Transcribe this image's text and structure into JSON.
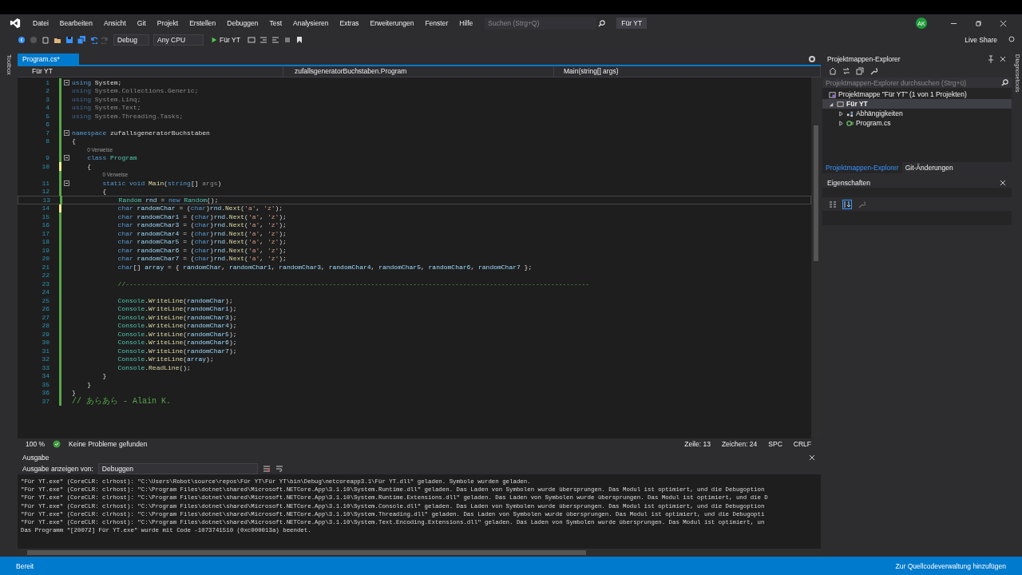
{
  "menu": [
    "Datei",
    "Bearbeiten",
    "Ansicht",
    "Git",
    "Projekt",
    "Erstellen",
    "Debuggen",
    "Test",
    "Analysieren",
    "Extras",
    "Erweiterungen",
    "Fenster",
    "Hilfe"
  ],
  "search": {
    "placeholder": "Suchen (Strg+Q)"
  },
  "solution_name": "Für YT",
  "account": "AK",
  "toolbar": {
    "config": "Debug",
    "platform": "Any CPU",
    "run": "Für YT"
  },
  "live_share": "Live Share",
  "toolbox_tab": "Toolbox",
  "diagnostics_tab": "Diagnosetools",
  "editor": {
    "tab": "Program.cs*",
    "nav": [
      "Für YT",
      "zufallsgeneratorBuchstaben.Program",
      "Main(string[] args)"
    ],
    "lines": [
      {
        "kind": "code",
        "n": "1",
        "fold": true,
        "unsaved": false,
        "current": false,
        "tokens": [
          {
            "kind": "kw",
            "text": "using"
          },
          {
            "kind": "p",
            "text": " System;"
          }
        ]
      },
      {
        "kind": "code",
        "n": "2",
        "fold": false,
        "unsaved": false,
        "current": false,
        "tokens": [
          {
            "kind": "kwdim",
            "text": "using"
          },
          {
            "kind": "dim",
            "text": " System.Collections.Generic;"
          }
        ]
      },
      {
        "kind": "code",
        "n": "3",
        "fold": false,
        "unsaved": false,
        "current": false,
        "tokens": [
          {
            "kind": "kwdim",
            "text": "using"
          },
          {
            "kind": "dim",
            "text": " System.Linq;"
          }
        ]
      },
      {
        "kind": "code",
        "n": "4",
        "fold": false,
        "unsaved": false,
        "current": false,
        "tokens": [
          {
            "kind": "kwdim",
            "text": "using"
          },
          {
            "kind": "dim",
            "text": " System.Text;"
          }
        ]
      },
      {
        "kind": "code",
        "n": "5",
        "fold": false,
        "unsaved": false,
        "current": false,
        "tokens": [
          {
            "kind": "kwdim",
            "text": "using"
          },
          {
            "kind": "dim",
            "text": " System.Threading.Tasks;"
          }
        ]
      },
      {
        "kind": "code",
        "n": "6",
        "fold": false,
        "unsaved": false,
        "current": false
      },
      {
        "kind": "code",
        "n": "7",
        "fold": true,
        "unsaved": false,
        "current": false,
        "tokens": [
          {
            "kind": "kw",
            "text": "namespace"
          },
          {
            "kind": "p",
            "text": " zufallsgeneratorBuchstaben"
          }
        ]
      },
      {
        "kind": "code",
        "n": "8",
        "fold": false,
        "unsaved": false,
        "current": false,
        "tokens": [
          {
            "kind": "p",
            "text": "{"
          }
        ]
      },
      {
        "kind": "lens",
        "text": "0 Verweise"
      },
      {
        "kind": "code",
        "n": "9",
        "fold": true,
        "unsaved": false,
        "current": false,
        "tokens": [
          {
            "kind": "kw",
            "text": "    class"
          },
          {
            "kind": "type",
            "text": " Program"
          }
        ]
      },
      {
        "kind": "code",
        "n": "10",
        "fold": false,
        "unsaved": true,
        "current": false,
        "tokens": [
          {
            "kind": "p",
            "text": "    {"
          }
        ]
      },
      {
        "kind": "lens",
        "text": "0 Verweise"
      },
      {
        "kind": "code",
        "n": "11",
        "fold": true,
        "unsaved": false,
        "current": false,
        "tokens": [
          {
            "kind": "kw",
            "text": "        static"
          },
          {
            "kind": "kw",
            "text": " void"
          },
          {
            "kind": "m",
            "text": " Main"
          },
          {
            "kind": "p",
            "text": "("
          },
          {
            "kind": "kw",
            "text": "string"
          },
          {
            "kind": "p",
            "text": "[] "
          },
          {
            "kind": "dim",
            "text": "args"
          },
          {
            "kind": "p",
            "text": ")"
          }
        ]
      },
      {
        "kind": "code",
        "n": "12",
        "fold": false,
        "unsaved": false,
        "current": false,
        "tokens": [
          {
            "kind": "p",
            "text": "        {"
          }
        ]
      },
      {
        "kind": "code",
        "n": "13",
        "fold": false,
        "unsaved": false,
        "current": true,
        "tokens": [
          {
            "kind": "type",
            "text": "            Random"
          },
          {
            "kind": "id",
            "text": " rnd"
          },
          {
            "kind": "p",
            "text": " = "
          },
          {
            "kind": "kw",
            "text": "new"
          },
          {
            "kind": "type",
            "text": " Random"
          },
          {
            "kind": "p",
            "text": "();"
          }
        ]
      },
      {
        "kind": "code",
        "n": "14",
        "fold": false,
        "unsaved": true,
        "current": false,
        "tokens": [
          {
            "kind": "kw",
            "text": "            char"
          },
          {
            "kind": "id",
            "text": " randomChar"
          },
          {
            "kind": "p",
            "text": " = ("
          },
          {
            "kind": "kw",
            "text": "char"
          },
          {
            "kind": "p",
            "text": ")"
          },
          {
            "kind": "id",
            "text": "rnd"
          },
          {
            "kind": "p",
            "text": "."
          },
          {
            "kind": "m",
            "text": "Next"
          },
          {
            "kind": "p",
            "text": "("
          },
          {
            "kind": "s",
            "text": "'a'"
          },
          {
            "kind": "p",
            "text": ", "
          },
          {
            "kind": "s",
            "text": "'z'"
          },
          {
            "kind": "p",
            "text": ");"
          }
        ]
      },
      {
        "kind": "code",
        "n": "15",
        "fold": false,
        "unsaved": false,
        "current": false,
        "tokens": [
          {
            "kind": "kw",
            "text": "            char"
          },
          {
            "kind": "id",
            "text": " randomChar1"
          },
          {
            "kind": "p",
            "text": " = ("
          },
          {
            "kind": "kw",
            "text": "char"
          },
          {
            "kind": "p",
            "text": ")"
          },
          {
            "kind": "id",
            "text": "rnd"
          },
          {
            "kind": "p",
            "text": "."
          },
          {
            "kind": "m",
            "text": "Next"
          },
          {
            "kind": "p",
            "text": "("
          },
          {
            "kind": "s",
            "text": "'a'"
          },
          {
            "kind": "p",
            "text": ", "
          },
          {
            "kind": "s",
            "text": "'z'"
          },
          {
            "kind": "p",
            "text": ");"
          }
        ]
      },
      {
        "kind": "code",
        "n": "16",
        "fold": false,
        "unsaved": false,
        "current": false,
        "tokens": [
          {
            "kind": "kw",
            "text": "            char"
          },
          {
            "kind": "id",
            "text": " randomChar3"
          },
          {
            "kind": "p",
            "text": " = ("
          },
          {
            "kind": "kw",
            "text": "char"
          },
          {
            "kind": "p",
            "text": ")"
          },
          {
            "kind": "id",
            "text": "rnd"
          },
          {
            "kind": "p",
            "text": "."
          },
          {
            "kind": "m",
            "text": "Next"
          },
          {
            "kind": "p",
            "text": "("
          },
          {
            "kind": "s",
            "text": "'a'"
          },
          {
            "kind": "p",
            "text": ", "
          },
          {
            "kind": "s",
            "text": "'z'"
          },
          {
            "kind": "p",
            "text": ");"
          }
        ]
      },
      {
        "kind": "code",
        "n": "17",
        "fold": false,
        "unsaved": false,
        "current": false,
        "tokens": [
          {
            "kind": "kw",
            "text": "            char"
          },
          {
            "kind": "id",
            "text": " randomChar4"
          },
          {
            "kind": "p",
            "text": " = ("
          },
          {
            "kind": "kw",
            "text": "char"
          },
          {
            "kind": "p",
            "text": ")"
          },
          {
            "kind": "id",
            "text": "rnd"
          },
          {
            "kind": "p",
            "text": "."
          },
          {
            "kind": "m",
            "text": "Next"
          },
          {
            "kind": "p",
            "text": "("
          },
          {
            "kind": "s",
            "text": "'a'"
          },
          {
            "kind": "p",
            "text": ", "
          },
          {
            "kind": "s",
            "text": "'z'"
          },
          {
            "kind": "p",
            "text": ");"
          }
        ]
      },
      {
        "kind": "code",
        "n": "18",
        "fold": false,
        "unsaved": false,
        "current": false,
        "tokens": [
          {
            "kind": "kw",
            "text": "            char"
          },
          {
            "kind": "id",
            "text": " randomChar5"
          },
          {
            "kind": "p",
            "text": " = ("
          },
          {
            "kind": "kw",
            "text": "char"
          },
          {
            "kind": "p",
            "text": ")"
          },
          {
            "kind": "id",
            "text": "rnd"
          },
          {
            "kind": "p",
            "text": "."
          },
          {
            "kind": "m",
            "text": "Next"
          },
          {
            "kind": "p",
            "text": "("
          },
          {
            "kind": "s",
            "text": "'a'"
          },
          {
            "kind": "p",
            "text": ", "
          },
          {
            "kind": "s",
            "text": "'z'"
          },
          {
            "kind": "p",
            "text": ");"
          }
        ]
      },
      {
        "kind": "code",
        "n": "19",
        "fold": false,
        "unsaved": false,
        "current": false,
        "tokens": [
          {
            "kind": "kw",
            "text": "            char"
          },
          {
            "kind": "id",
            "text": " randomChar6"
          },
          {
            "kind": "p",
            "text": " = ("
          },
          {
            "kind": "kw",
            "text": "char"
          },
          {
            "kind": "p",
            "text": ")"
          },
          {
            "kind": "id",
            "text": "rnd"
          },
          {
            "kind": "p",
            "text": "."
          },
          {
            "kind": "m",
            "text": "Next"
          },
          {
            "kind": "p",
            "text": "("
          },
          {
            "kind": "s",
            "text": "'a'"
          },
          {
            "kind": "p",
            "text": ", "
          },
          {
            "kind": "s",
            "text": "'z'"
          },
          {
            "kind": "p",
            "text": ");"
          }
        ]
      },
      {
        "kind": "code",
        "n": "20",
        "fold": false,
        "unsaved": false,
        "current": false,
        "tokens": [
          {
            "kind": "kw",
            "text": "            char"
          },
          {
            "kind": "id",
            "text": " randomChar7"
          },
          {
            "kind": "p",
            "text": " = ("
          },
          {
            "kind": "kw",
            "text": "char"
          },
          {
            "kind": "p",
            "text": ")"
          },
          {
            "kind": "id",
            "text": "rnd"
          },
          {
            "kind": "p",
            "text": "."
          },
          {
            "kind": "m",
            "text": "Next"
          },
          {
            "kind": "p",
            "text": "("
          },
          {
            "kind": "s",
            "text": "'a'"
          },
          {
            "kind": "p",
            "text": ", "
          },
          {
            "kind": "s",
            "text": "'z'"
          },
          {
            "kind": "p",
            "text": ");"
          }
        ]
      },
      {
        "kind": "code",
        "n": "21",
        "fold": false,
        "unsaved": false,
        "current": false,
        "tokens": [
          {
            "kind": "kw",
            "text": "            char"
          },
          {
            "kind": "p",
            "text": "[] "
          },
          {
            "kind": "id",
            "text": "array"
          },
          {
            "kind": "p",
            "text": " = { "
          },
          {
            "kind": "id",
            "text": "randomChar"
          },
          {
            "kind": "p",
            "text": ", "
          },
          {
            "kind": "id",
            "text": "randomChar1"
          },
          {
            "kind": "p",
            "text": ", "
          },
          {
            "kind": "id",
            "text": "randomChar3"
          },
          {
            "kind": "p",
            "text": ", "
          },
          {
            "kind": "id",
            "text": "randomChar4"
          },
          {
            "kind": "p",
            "text": ", "
          },
          {
            "kind": "id",
            "text": "randomChar5"
          },
          {
            "kind": "p",
            "text": ", "
          },
          {
            "kind": "id",
            "text": "randomChar6"
          },
          {
            "kind": "p",
            "text": ", "
          },
          {
            "kind": "id",
            "text": "randomChar7"
          },
          {
            "kind": "p",
            "text": " };"
          }
        ]
      },
      {
        "kind": "code",
        "n": "22",
        "fold": false,
        "unsaved": false,
        "current": false
      },
      {
        "kind": "code",
        "n": "23",
        "fold": false,
        "unsaved": false,
        "current": false,
        "tokens": [
          {
            "kind": "c",
            "text": "            //-------------------------------------------------------------------------------------------------------------------------"
          }
        ]
      },
      {
        "kind": "code",
        "n": "24",
        "fold": false,
        "unsaved": false,
        "current": false
      },
      {
        "kind": "code",
        "n": "25",
        "fold": false,
        "unsaved": false,
        "current": false,
        "tokens": [
          {
            "kind": "type",
            "text": "            Console"
          },
          {
            "kind": "p",
            "text": "."
          },
          {
            "kind": "m",
            "text": "WriteLine"
          },
          {
            "kind": "p",
            "text": "("
          },
          {
            "kind": "id",
            "text": "randomChar"
          },
          {
            "kind": "p",
            "text": ");"
          }
        ]
      },
      {
        "kind": "code",
        "n": "26",
        "fold": false,
        "unsaved": false,
        "current": false,
        "tokens": [
          {
            "kind": "type",
            "text": "            Console"
          },
          {
            "kind": "p",
            "text": "."
          },
          {
            "kind": "m",
            "text": "WriteLine"
          },
          {
            "kind": "p",
            "text": "("
          },
          {
            "kind": "id",
            "text": "randomChar1"
          },
          {
            "kind": "p",
            "text": ");"
          }
        ]
      },
      {
        "kind": "code",
        "n": "27",
        "fold": false,
        "unsaved": false,
        "current": false,
        "tokens": [
          {
            "kind": "type",
            "text": "            Console"
          },
          {
            "kind": "p",
            "text": "."
          },
          {
            "kind": "m",
            "text": "WriteLine"
          },
          {
            "kind": "p",
            "text": "("
          },
          {
            "kind": "id",
            "text": "randomChar3"
          },
          {
            "kind": "p",
            "text": ");"
          }
        ]
      },
      {
        "kind": "code",
        "n": "28",
        "fold": false,
        "unsaved": false,
        "current": false,
        "tokens": [
          {
            "kind": "type",
            "text": "            Console"
          },
          {
            "kind": "p",
            "text": "."
          },
          {
            "kind": "m",
            "text": "WriteLine"
          },
          {
            "kind": "p",
            "text": "("
          },
          {
            "kind": "id",
            "text": "randomChar4"
          },
          {
            "kind": "p",
            "text": ");"
          }
        ]
      },
      {
        "kind": "code",
        "n": "29",
        "fold": false,
        "unsaved": false,
        "current": false,
        "tokens": [
          {
            "kind": "type",
            "text": "            Console"
          },
          {
            "kind": "p",
            "text": "."
          },
          {
            "kind": "m",
            "text": "WriteLine"
          },
          {
            "kind": "p",
            "text": "("
          },
          {
            "kind": "id",
            "text": "randomChar5"
          },
          {
            "kind": "p",
            "text": ");"
          }
        ]
      },
      {
        "kind": "code",
        "n": "30",
        "fold": false,
        "unsaved": false,
        "current": false,
        "tokens": [
          {
            "kind": "type",
            "text": "            Console"
          },
          {
            "kind": "p",
            "text": "."
          },
          {
            "kind": "m",
            "text": "WriteLine"
          },
          {
            "kind": "p",
            "text": "("
          },
          {
            "kind": "id",
            "text": "randomChar6"
          },
          {
            "kind": "p",
            "text": ");"
          }
        ]
      },
      {
        "kind": "code",
        "n": "31",
        "fold": false,
        "unsaved": false,
        "current": false,
        "tokens": [
          {
            "kind": "type",
            "text": "            Console"
          },
          {
            "kind": "p",
            "text": "."
          },
          {
            "kind": "m",
            "text": "WriteLine"
          },
          {
            "kind": "p",
            "text": "("
          },
          {
            "kind": "id",
            "text": "randomChar7"
          },
          {
            "kind": "p",
            "text": ");"
          }
        ]
      },
      {
        "kind": "code",
        "n": "32",
        "fold": false,
        "unsaved": false,
        "current": false,
        "tokens": [
          {
            "kind": "type",
            "text": "            Console"
          },
          {
            "kind": "p",
            "text": "."
          },
          {
            "kind": "m",
            "text": "WriteLine"
          },
          {
            "kind": "p",
            "text": "("
          },
          {
            "kind": "id",
            "text": "array"
          },
          {
            "kind": "p",
            "text": ");"
          }
        ]
      },
      {
        "kind": "code",
        "n": "33",
        "fold": false,
        "unsaved": false,
        "current": false,
        "tokens": [
          {
            "kind": "type",
            "text": "            Console"
          },
          {
            "kind": "p",
            "text": "."
          },
          {
            "kind": "m",
            "text": "ReadLine"
          },
          {
            "kind": "p",
            "text": "();"
          }
        ]
      },
      {
        "kind": "code",
        "n": "34",
        "fold": false,
        "unsaved": false,
        "current": false,
        "tokens": [
          {
            "kind": "p",
            "text": "        }"
          }
        ]
      },
      {
        "kind": "code",
        "n": "35",
        "fold": false,
        "unsaved": false,
        "current": false,
        "tokens": [
          {
            "kind": "p",
            "text": "    }"
          }
        ]
      },
      {
        "kind": "code",
        "n": "36",
        "fold": false,
        "unsaved": false,
        "current": false,
        "tokens": [
          {
            "kind": "p",
            "text": "}"
          }
        ]
      },
      {
        "kind": "code",
        "n": "37",
        "fold": false,
        "unsaved": false,
        "current": false,
        "tokens": [
          {
            "kind": "c",
            "text": "// あらあら - Alain K."
          }
        ]
      }
    ],
    "zoom": "100 %",
    "issues": "Keine Probleme gefunden",
    "position_line": "Zeile: 13",
    "position_col": "Zeichen: 24",
    "whitespace": "SPC",
    "line_ending": "CRLF"
  },
  "solution_explorer": {
    "title": "Projektmappen-Explorer",
    "search": {
      "placeholder": "Projektmappen-Explorer durchsuchen (Strg+ü)"
    },
    "tree": [
      {
        "kind": "solution",
        "label": "Projektmappe \"Für YT\" (1 von 1 Projekten)",
        "selected": false,
        "children": [
          {
            "kind": "project",
            "label": "Für YT",
            "expanded": true,
            "selected": true,
            "children": [
              {
                "kind": "dependencies",
                "label": "Abhängigkeiten",
                "expanded": false,
                "selected": false
              },
              {
                "kind": "file",
                "label": "Program.cs",
                "expanded": false,
                "selected": false
              }
            ]
          }
        ]
      }
    ],
    "tabs": [
      {
        "label": "Projektmappen-Explorer",
        "selected": true
      },
      {
        "label": "Git-Änderungen",
        "selected": false
      }
    ]
  },
  "properties": {
    "title": "Eigenschaften"
  },
  "output": {
    "title": "Ausgabe",
    "source_label": "Ausgabe anzeigen von:",
    "source": "Debuggen",
    "lines": [
      "\"Für YT.exe\" (CoreCLR: clrhost): \"C:\\Users\\Robot\\source\\repos\\Für YT\\Für YT\\bin\\Debug\\netcoreapp3.1\\Für YT.dll\" geladen. Symbole wurden geladen.",
      "\"Für YT.exe\" (CoreCLR: clrhost): \"C:\\Program Files\\dotnet\\shared\\Microsoft.NETCore.App\\3.1.10\\System.Runtime.dll\" geladen. Das Laden von Symbolen wurde übersprungen. Das Modul ist optimiert, und die Debugoption",
      "\"Für YT.exe\" (CoreCLR: clrhost): \"C:\\Program Files\\dotnet\\shared\\Microsoft.NETCore.App\\3.1.10\\System.Runtime.Extensions.dll\" geladen. Das Laden von Symbolen wurde übersprungen. Das Modul ist optimiert, und die D",
      "\"Für YT.exe\" (CoreCLR: clrhost): \"C:\\Program Files\\dotnet\\shared\\Microsoft.NETCore.App\\3.1.10\\System.Console.dll\" geladen. Das Laden von Symbolen wurde übersprungen. Das Modul ist optimiert, und die Debugoption",
      "\"Für YT.exe\" (CoreCLR: clrhost): \"C:\\Program Files\\dotnet\\shared\\Microsoft.NETCore.App\\3.1.10\\System.Threading.dll\" geladen. Das Laden von Symbolen wurde übersprungen. Das Modul ist optimiert, und die Debugopti",
      "\"Für YT.exe\" (CoreCLR: clrhost): \"C:\\Program Files\\dotnet\\shared\\Microsoft.NETCore.App\\3.1.10\\System.Text.Encoding.Extensions.dll\" geladen. Das Laden von Symbolen wurde übersprungen. Das Modul ist optimiert, un",
      "Das Programm \"[20072] Für YT.exe\" wurde mit Code -1073741510 (0xc000013a) beendet."
    ]
  },
  "status_bar": {
    "text": "Bereit",
    "action": "Zur Quellcodeverwaltung hinzufügen"
  }
}
